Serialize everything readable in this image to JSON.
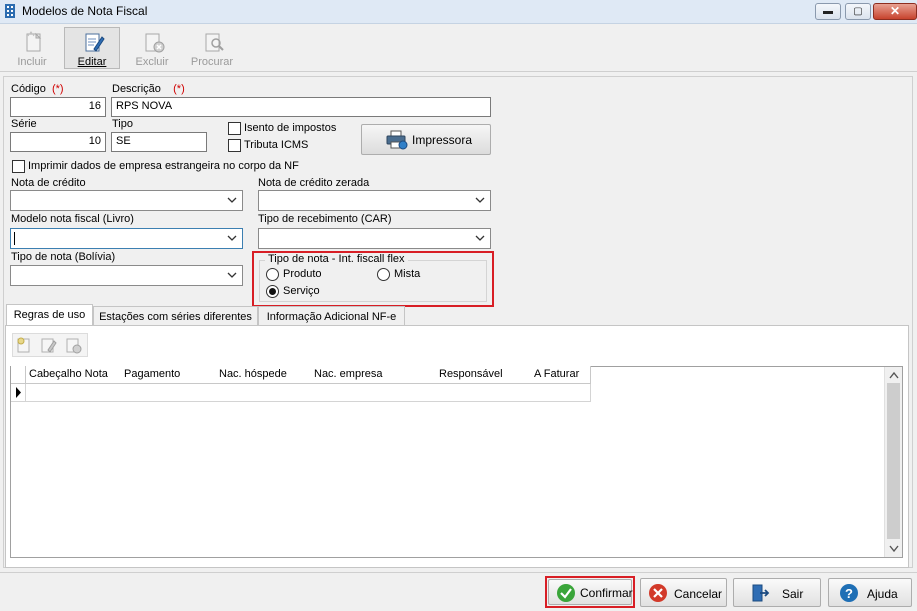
{
  "window": {
    "title": "Modelos de Nota Fiscal",
    "minimize_glyph": "▬",
    "maximize_glyph": "▢",
    "close_glyph": "✕"
  },
  "toolbar": {
    "incluir": "Incluir",
    "editar": "Editar",
    "excluir": "Excluir",
    "procurar": "Procurar"
  },
  "form": {
    "codigo_label": "Código",
    "required_mark": "(*)",
    "codigo_value": "16",
    "descricao_label": "Descrição",
    "descricao_value": "RPS NOVA",
    "serie_label": "Série",
    "serie_value": "10",
    "tipo_label": "Tipo",
    "tipo_value": "SE",
    "isento_label": "Isento de impostos",
    "tributa_label": "Tributa ICMS",
    "impressora_label": "Impressora",
    "imprimir_estrangeira_label": "Imprimir dados de empresa estrangeira no corpo da NF",
    "nota_credito_label": "Nota de crédito",
    "nota_credito_zerada_label": "Nota de crédito zerada",
    "modelo_livro_label": "Modelo nota fiscal (Livro)",
    "tipo_recebimento_label": "Tipo de recebimento (CAR)",
    "tipo_nota_bolivia_label": "Tipo de nota (Bolívia)",
    "tipo_nota_flex": {
      "legend": "Tipo de nota - Int. fiscall flex",
      "produto": "Produto",
      "mista": "Mista",
      "servico": "Serviço",
      "selected": "Serviço"
    }
  },
  "tabs": [
    {
      "label": "Regras de uso",
      "active": true
    },
    {
      "label": "Estações com séries diferentes",
      "active": false
    },
    {
      "label": "Informação Adicional NF-e",
      "active": false
    }
  ],
  "grid": {
    "columns": [
      "Cabeçalho Nota",
      "Pagamento",
      "Nac. hóspede",
      "Nac. empresa",
      "Responsável",
      "A Faturar"
    ]
  },
  "footer": {
    "confirmar": "Confirmar",
    "cancelar": "Cancelar",
    "sair": "Sair",
    "ajuda": "Ajuda"
  },
  "colors": {
    "highlight": "#d81e25",
    "accent_blue": "#1f6fb5",
    "confirm_green": "#3aa53a",
    "cancel_red": "#d23a2a"
  }
}
